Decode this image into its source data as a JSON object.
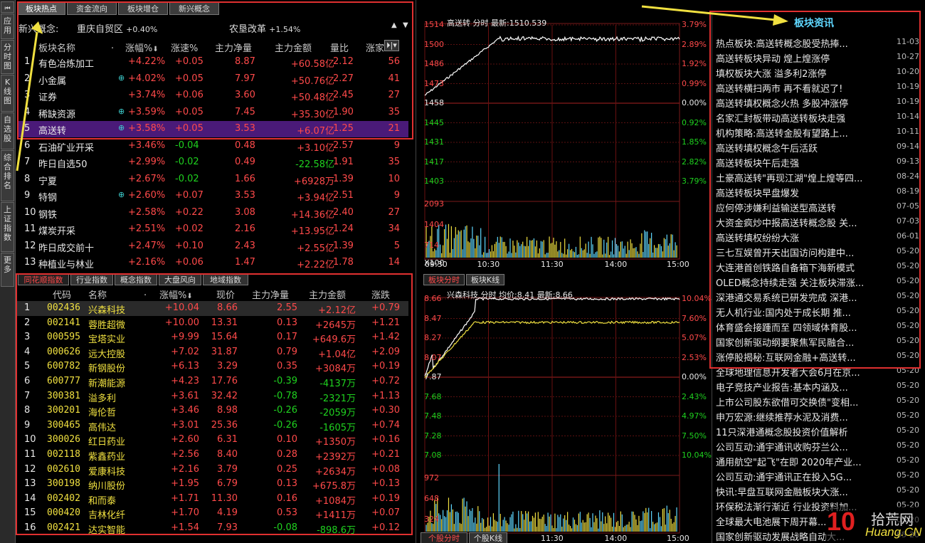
{
  "left_nav": [
    "应用",
    "分时图",
    "K线图",
    "自选股",
    "综合排名",
    "上证指数",
    "更多"
  ],
  "top_tabs": [
    "板块热点",
    "资金流向",
    "板块增仓",
    "新兴概念"
  ],
  "concept_bar": {
    "label": "新兴概念:",
    "items": [
      {
        "name": "重庆自贸区",
        "pct": "+0.40%"
      },
      {
        "name": "农垦改革",
        "pct": "+1.54%"
      }
    ]
  },
  "sector_headers": [
    "板块名称",
    "涨幅%",
    "涨速%",
    "主力净量",
    "主力金额",
    "量比",
    "涨家"
  ],
  "sectors": [
    {
      "no": "1",
      "name": "有色冶炼加工",
      "plus": false,
      "chg": "+4.22%",
      "spd": "+0.05",
      "net": "8.87",
      "amt": "+60.58亿",
      "ratio": "2.12",
      "up": "56"
    },
    {
      "no": "2",
      "name": "小金属",
      "plus": true,
      "chg": "+4.02%",
      "spd": "+0.05",
      "net": "7.97",
      "amt": "+50.76亿",
      "ratio": "2.27",
      "up": "41"
    },
    {
      "no": "3",
      "name": "证券",
      "plus": false,
      "chg": "+3.74%",
      "spd": "+0.06",
      "net": "3.60",
      "amt": "+50.48亿",
      "ratio": "2.45",
      "up": "27"
    },
    {
      "no": "4",
      "name": "稀缺资源",
      "plus": true,
      "chg": "+3.59%",
      "spd": "+0.05",
      "net": "7.45",
      "amt": "+35.30亿",
      "ratio": "1.90",
      "up": "35"
    },
    {
      "no": "5",
      "name": "高送转",
      "plus": true,
      "chg": "+3.58%",
      "spd": "+0.05",
      "net": "3.53",
      "amt": "+6.07亿",
      "ratio": "1.25",
      "up": "21"
    },
    {
      "no": "6",
      "name": "石油矿业开采",
      "plus": false,
      "chg": "+3.46%",
      "spd": "-0.04",
      "net": "0.48",
      "amt": "+3.10亿",
      "ratio": "2.57",
      "up": "9"
    },
    {
      "no": "7",
      "name": "昨日自选50",
      "plus": false,
      "chg": "+2.99%",
      "spd": "-0.02",
      "net": "0.49",
      "amt": "-22.58亿",
      "ratio": "1.91",
      "up": "35"
    },
    {
      "no": "8",
      "name": "宁夏",
      "plus": false,
      "chg": "+2.67%",
      "spd": "-0.02",
      "net": "1.66",
      "amt": "+6928万",
      "ratio": "1.39",
      "up": "10"
    },
    {
      "no": "9",
      "name": "特钢",
      "plus": true,
      "chg": "+2.60%",
      "spd": "+0.07",
      "net": "3.53",
      "amt": "+3.94亿",
      "ratio": "2.51",
      "up": "9"
    },
    {
      "no": "10",
      "name": "钢铁",
      "plus": false,
      "chg": "+2.58%",
      "spd": "+0.22",
      "net": "3.08",
      "amt": "+14.36亿",
      "ratio": "2.40",
      "up": "27"
    },
    {
      "no": "11",
      "name": "煤炭开采",
      "plus": false,
      "chg": "+2.51%",
      "spd": "+0.02",
      "net": "2.16",
      "amt": "+13.95亿",
      "ratio": "1.24",
      "up": "34"
    },
    {
      "no": "12",
      "name": "昨日成交前十",
      "plus": false,
      "chg": "+2.47%",
      "spd": "+0.10",
      "net": "2.43",
      "amt": "+2.55亿",
      "ratio": "1.39",
      "up": "5"
    },
    {
      "no": "13",
      "name": "种植业与林业",
      "plus": false,
      "chg": "+2.16%",
      "spd": "+0.06",
      "net": "1.47",
      "amt": "+2.22亿",
      "ratio": "1.78",
      "up": "14"
    }
  ],
  "bottom_tabs": [
    "同花顺指数",
    "行业指数",
    "概念指数",
    "大盘风向",
    "地域指数"
  ],
  "stock_headers": [
    "代码",
    "名称",
    "涨幅%",
    "现价",
    "主力净量",
    "主力金额",
    "涨跌"
  ],
  "stocks": [
    {
      "no": "1",
      "code": "002436",
      "name": "兴森科技",
      "chg": "+10.04",
      "price": "8.66",
      "net": "2.55",
      "amt": "+2.12亿",
      "diff": "+0.79"
    },
    {
      "no": "2",
      "code": "002141",
      "name": "蓉胜超微",
      "chg": "+10.00",
      "price": "13.31",
      "net": "0.13",
      "amt": "+2645万",
      "diff": "+1.21"
    },
    {
      "no": "3",
      "code": "000595",
      "name": "宝塔实业",
      "chg": "+9.99",
      "price": "15.64",
      "net": "0.17",
      "amt": "+649.6万",
      "diff": "+1.42"
    },
    {
      "no": "4",
      "code": "000626",
      "name": "远大控股",
      "chg": "+7.02",
      "price": "31.87",
      "net": "0.79",
      "amt": "+1.04亿",
      "diff": "+2.09"
    },
    {
      "no": "5",
      "code": "600782",
      "name": "新钢股份",
      "chg": "+6.13",
      "price": "3.29",
      "net": "0.35",
      "amt": "+3084万",
      "diff": "+0.19"
    },
    {
      "no": "6",
      "code": "600777",
      "name": "新潮能源",
      "chg": "+4.23",
      "price": "17.76",
      "net": "-0.39",
      "amt": "-4137万",
      "diff": "+0.72"
    },
    {
      "no": "7",
      "code": "300381",
      "name": "溢多利",
      "chg": "+3.61",
      "price": "32.42",
      "net": "-0.78",
      "amt": "-2321万",
      "diff": "+1.13"
    },
    {
      "no": "8",
      "code": "300201",
      "name": "海伦哲",
      "chg": "+3.46",
      "price": "8.98",
      "net": "-0.26",
      "amt": "-2059万",
      "diff": "+0.30"
    },
    {
      "no": "9",
      "code": "300465",
      "name": "高伟达",
      "chg": "+3.01",
      "price": "25.36",
      "net": "-0.26",
      "amt": "-1605万",
      "diff": "+0.74"
    },
    {
      "no": "10",
      "code": "300026",
      "name": "红日药业",
      "chg": "+2.60",
      "price": "6.31",
      "net": "0.10",
      "amt": "+1350万",
      "diff": "+0.16"
    },
    {
      "no": "11",
      "code": "002118",
      "name": "紫鑫药业",
      "chg": "+2.56",
      "price": "8.40",
      "net": "0.28",
      "amt": "+2392万",
      "diff": "+0.21"
    },
    {
      "no": "12",
      "code": "002610",
      "name": "爱康科技",
      "chg": "+2.16",
      "price": "3.79",
      "net": "0.25",
      "amt": "+2634万",
      "diff": "+0.08"
    },
    {
      "no": "13",
      "code": "300198",
      "name": "纳川股份",
      "chg": "+1.95",
      "price": "6.79",
      "net": "0.13",
      "amt": "+675.8万",
      "diff": "+0.13"
    },
    {
      "no": "14",
      "code": "002402",
      "name": "和而泰",
      "chg": "+1.71",
      "price": "11.30",
      "net": "0.16",
      "amt": "+1084万",
      "diff": "+0.19"
    },
    {
      "no": "15",
      "code": "000420",
      "name": "吉林化纤",
      "chg": "+1.70",
      "price": "4.19",
      "net": "0.53",
      "amt": "+1411万",
      "diff": "+0.07"
    },
    {
      "no": "16",
      "code": "002421",
      "name": "达实智能",
      "chg": "+1.54",
      "price": "7.93",
      "net": "-0.08",
      "amt": "-898.6万",
      "diff": "+0.12"
    }
  ],
  "chart1": {
    "title": "高送转",
    "subtitle": "分时",
    "latest_label": "最新:",
    "latest": "1510.539",
    "price_ticks": [
      "1514",
      "1500",
      "1486",
      "1473",
      "1458",
      "1445",
      "1431",
      "1417",
      "1403"
    ],
    "pct_ticks": [
      "3.79%",
      "2.89%",
      "1.92%",
      "0.99%",
      "0.00%",
      "0.92%",
      "1.85%",
      "2.82%",
      "3.79%"
    ],
    "vol_ticks": [
      "2093",
      "1404",
      "714"
    ],
    "vol_unit": "X100",
    "time_ticks": [
      "09:30",
      "10:30",
      "11:30",
      "14:00",
      "15:00"
    ],
    "tabs": [
      "板块分时",
      "板块K线"
    ]
  },
  "chart2": {
    "title": "兴森科技",
    "subtitle": "分时",
    "avg_label": "均价:",
    "avg": "8.41",
    "latest_label": "最新:",
    "latest": "8.66",
    "price_ticks": [
      "8.66",
      "8.47",
      "8.27",
      "8.07",
      "7.87",
      "7.68",
      "7.48",
      "7.28",
      "7.08"
    ],
    "pct_ticks": [
      "10.04%",
      "7.60%",
      "5.07%",
      "2.53%",
      "0.00%",
      "2.43%",
      "4.97%",
      "7.50%",
      "10.04%"
    ],
    "vol_ticks": [
      "972",
      "648",
      "324"
    ],
    "vol_unit": "X100",
    "time_ticks": [
      "09:30",
      "10:30",
      "11:30",
      "14:00",
      "15:00"
    ],
    "tabs": [
      "个股分时",
      "个股K线"
    ]
  },
  "news_panel": {
    "title": "板块资讯",
    "items": [
      {
        "t": "热点板块:高送转概念股受热捧...",
        "d": "11-03"
      },
      {
        "t": "高送转板块异动 煌上煌涨停",
        "d": "10-27"
      },
      {
        "t": "填权板块大涨 溢多利2涨停",
        "d": "10-20"
      },
      {
        "t": "高送转横扫两市 再不看就迟了!",
        "d": "10-19"
      },
      {
        "t": "高送转填权概念火热 多股冲涨停",
        "d": "10-19"
      },
      {
        "t": "名家汇封板带动高送转板块走强",
        "d": "10-14"
      },
      {
        "t": "机构策略:高送转金股有望路上...",
        "d": "10-11"
      },
      {
        "t": "高送转填权概念午后活跃",
        "d": "09-14"
      },
      {
        "t": "高送转板块午后走强",
        "d": "09-13"
      },
      {
        "t": "土豪高送转\"再现江湖\"煌上煌等四...",
        "d": "08-24"
      },
      {
        "t": "高送转板块早盘爆发",
        "d": "08-19"
      },
      {
        "t": "应何停涉嫌利益输送型高送转",
        "d": "07-05"
      },
      {
        "t": "大资金疯炒中报高送转概念股 关...",
        "d": "07-03"
      },
      {
        "t": "高送转填权纷纷大涨",
        "d": "06-01"
      },
      {
        "t": "三七互娱曾开天出国访问构建中...",
        "d": "05-20"
      },
      {
        "t": "大连港首创铁路自备箱下海新模式",
        "d": "05-20"
      },
      {
        "t": "OLED概念持续走强 关注板块滞涨...",
        "d": "05-20"
      },
      {
        "t": "深港通交易系统已研发完成 深港...",
        "d": "05-20"
      },
      {
        "t": "无人机行业:国内处于成长期 推...",
        "d": "05-20"
      },
      {
        "t": "体育盛会接踵而至 四领域体育股...",
        "d": "05-20"
      },
      {
        "t": "国家创新驱动纲要聚焦军民融合...",
        "d": "05-20"
      },
      {
        "t": "涨停股揭秘:互联网金融+高送转...",
        "d": "05-20"
      },
      {
        "t": "全球地理信息开发者大会6月在京...",
        "d": "05-20"
      },
      {
        "t": "电子竞技产业报告:基本内涵及...",
        "d": "05-20"
      },
      {
        "t": "上市公司股东欲借可交换债\"变相...",
        "d": "05-20"
      },
      {
        "t": "申万宏源:继续推荐水泥及消费...",
        "d": "05-20"
      },
      {
        "t": "11只深港通概念股投资价值解析",
        "d": "05-20"
      },
      {
        "t": "公司互动:通宇通讯收购芬兰公...",
        "d": "05-20"
      },
      {
        "t": "通用航空\"起飞\"在即 2020年产业...",
        "d": "05-20"
      },
      {
        "t": "公司互动:通宇通讯正在投入5G...",
        "d": "05-20"
      },
      {
        "t": "快讯:早盘互联网金融板块大涨...",
        "d": "05-20"
      },
      {
        "t": "环保税法渐行渐近 行业投资料加...",
        "d": "05-20"
      },
      {
        "t": "全球最大电池展下周开幕...",
        "d": "05-20"
      },
      {
        "t": "国家创新驱动发展战略自动大...",
        "d": "05-20"
      }
    ]
  },
  "watermark": {
    "main": "10",
    "brand": "拾荒网",
    "url": "Huang.CN"
  },
  "colors": {
    "up": "#ff4a4a",
    "down": "#1fd21f",
    "accent": "#f0e040",
    "highlight": "#7a1e8a",
    "annotation": "#e03030"
  }
}
